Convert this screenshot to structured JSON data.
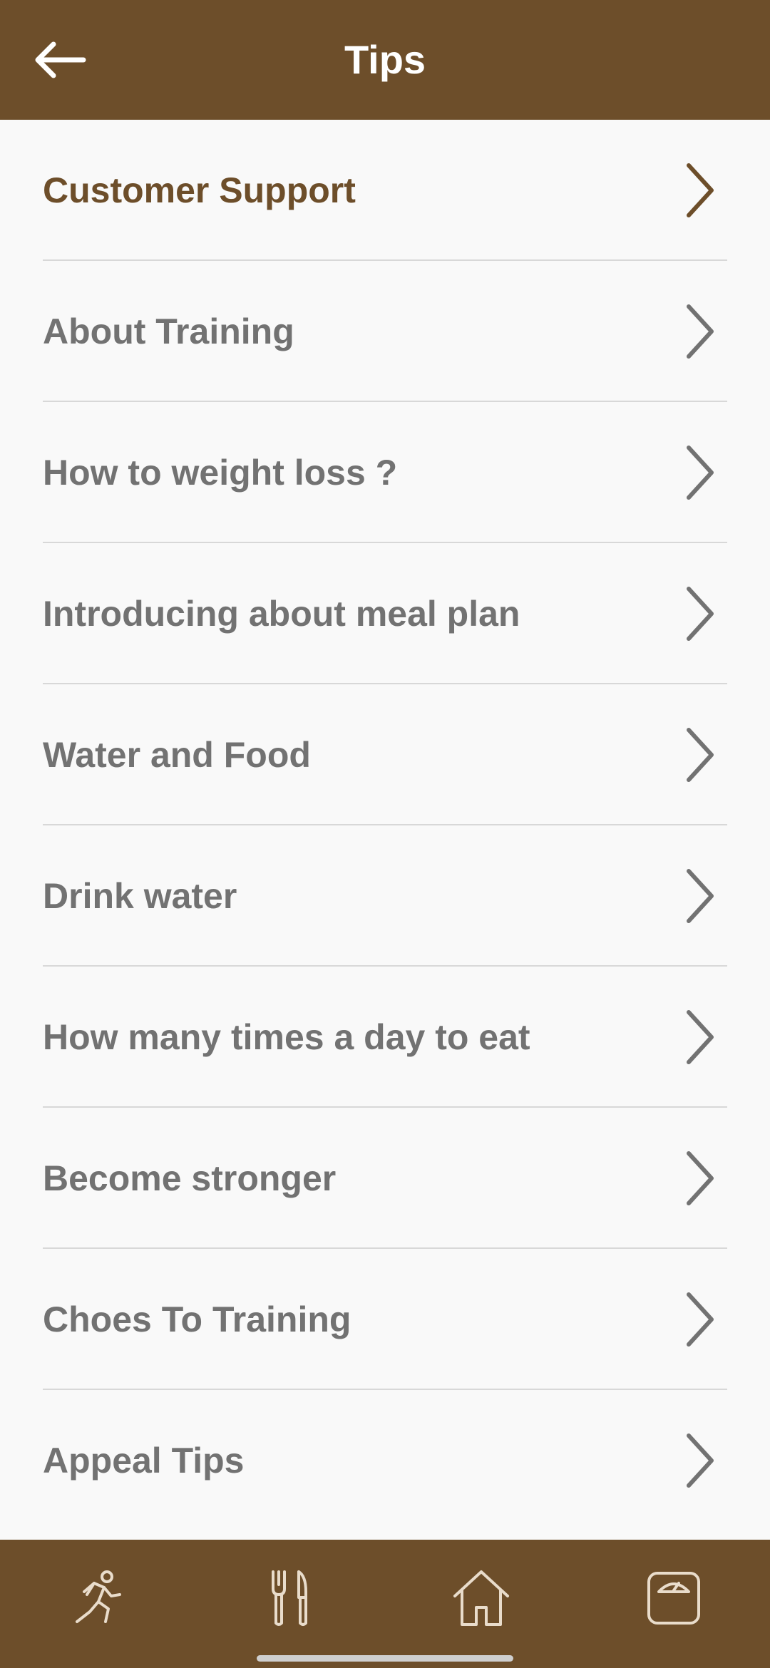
{
  "header": {
    "title": "Tips",
    "back_icon": "arrow-left-icon"
  },
  "colors": {
    "brand": "#6d4e2a",
    "item_text": "#727272",
    "active_text": "#6d4e2a",
    "background": "#f9f9f9"
  },
  "items": [
    {
      "label": "Customer Support",
      "active": true
    },
    {
      "label": "About Training"
    },
    {
      "label": "How to weight loss ?"
    },
    {
      "label": "Introducing about meal plan"
    },
    {
      "label": "Water and Food"
    },
    {
      "label": "Drink water"
    },
    {
      "label": "How many times a day to eat"
    },
    {
      "label": "Become stronger"
    },
    {
      "label": "Choes To Training"
    },
    {
      "label": "Appeal Tips"
    }
  ],
  "bottom_nav": [
    {
      "icon": "running-person-icon"
    },
    {
      "icon": "fork-knife-icon"
    },
    {
      "icon": "home-icon"
    },
    {
      "icon": "weight-scale-icon"
    }
  ]
}
